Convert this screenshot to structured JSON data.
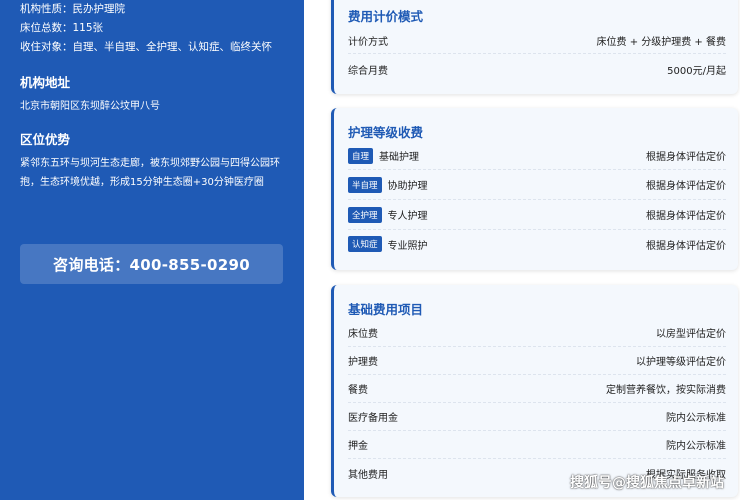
{
  "left": {
    "info": {
      "nature": "机构性质：民办护理院",
      "beds": "床位总数：115张",
      "targets": "收住对象：自理、半自理、全护理、认知症、临终关怀"
    },
    "address_title": "机构地址",
    "address": "北京市朝阳区东坝醉公坟甲八号",
    "advantage_title": "区位优势",
    "advantage": "紧邻东五环与坝河生态走廊，被东坝郊野公园与四得公园环抱，生态环境优越，形成15分钟生态圈+30分钟医疗圈",
    "phone": "咨询电话：400-855-0290"
  },
  "pricing_mode": {
    "title": "费用计价模式",
    "rows": [
      {
        "label": "计价方式",
        "value": "床位费 + 分级护理费 + 餐费"
      },
      {
        "label": "综合月费",
        "value": "5000元/月起"
      }
    ]
  },
  "care_levels": {
    "title": "护理等级收费",
    "rows": [
      {
        "badge": "自理",
        "label": "基础护理",
        "value": "根据身体评估定价"
      },
      {
        "badge": "半自理",
        "label": "协助护理",
        "value": "根据身体评估定价"
      },
      {
        "badge": "全护理",
        "label": "专人护理",
        "value": "根据身体评估定价"
      },
      {
        "badge": "认知症",
        "label": "专业照护",
        "value": "根据身体评估定价"
      }
    ]
  },
  "basic_fees": {
    "title": "基础费用项目",
    "rows": [
      {
        "label": "床位费",
        "value": "以房型评估定价"
      },
      {
        "label": "护理费",
        "value": "以护理等级评估定价"
      },
      {
        "label": "餐费",
        "value": "定制营养餐饮，按实际消费"
      },
      {
        "label": "医疗备用金",
        "value": "院内公示标准"
      },
      {
        "label": "押金",
        "value": "院内公示标准"
      },
      {
        "label": "其他费用",
        "value": "根据实际服务收取"
      }
    ]
  },
  "watermark": "搜狐号@搜狐焦点卓新站",
  "colors": {
    "primary": "#1f5ab5",
    "card_bg": "#f4f8fd"
  }
}
